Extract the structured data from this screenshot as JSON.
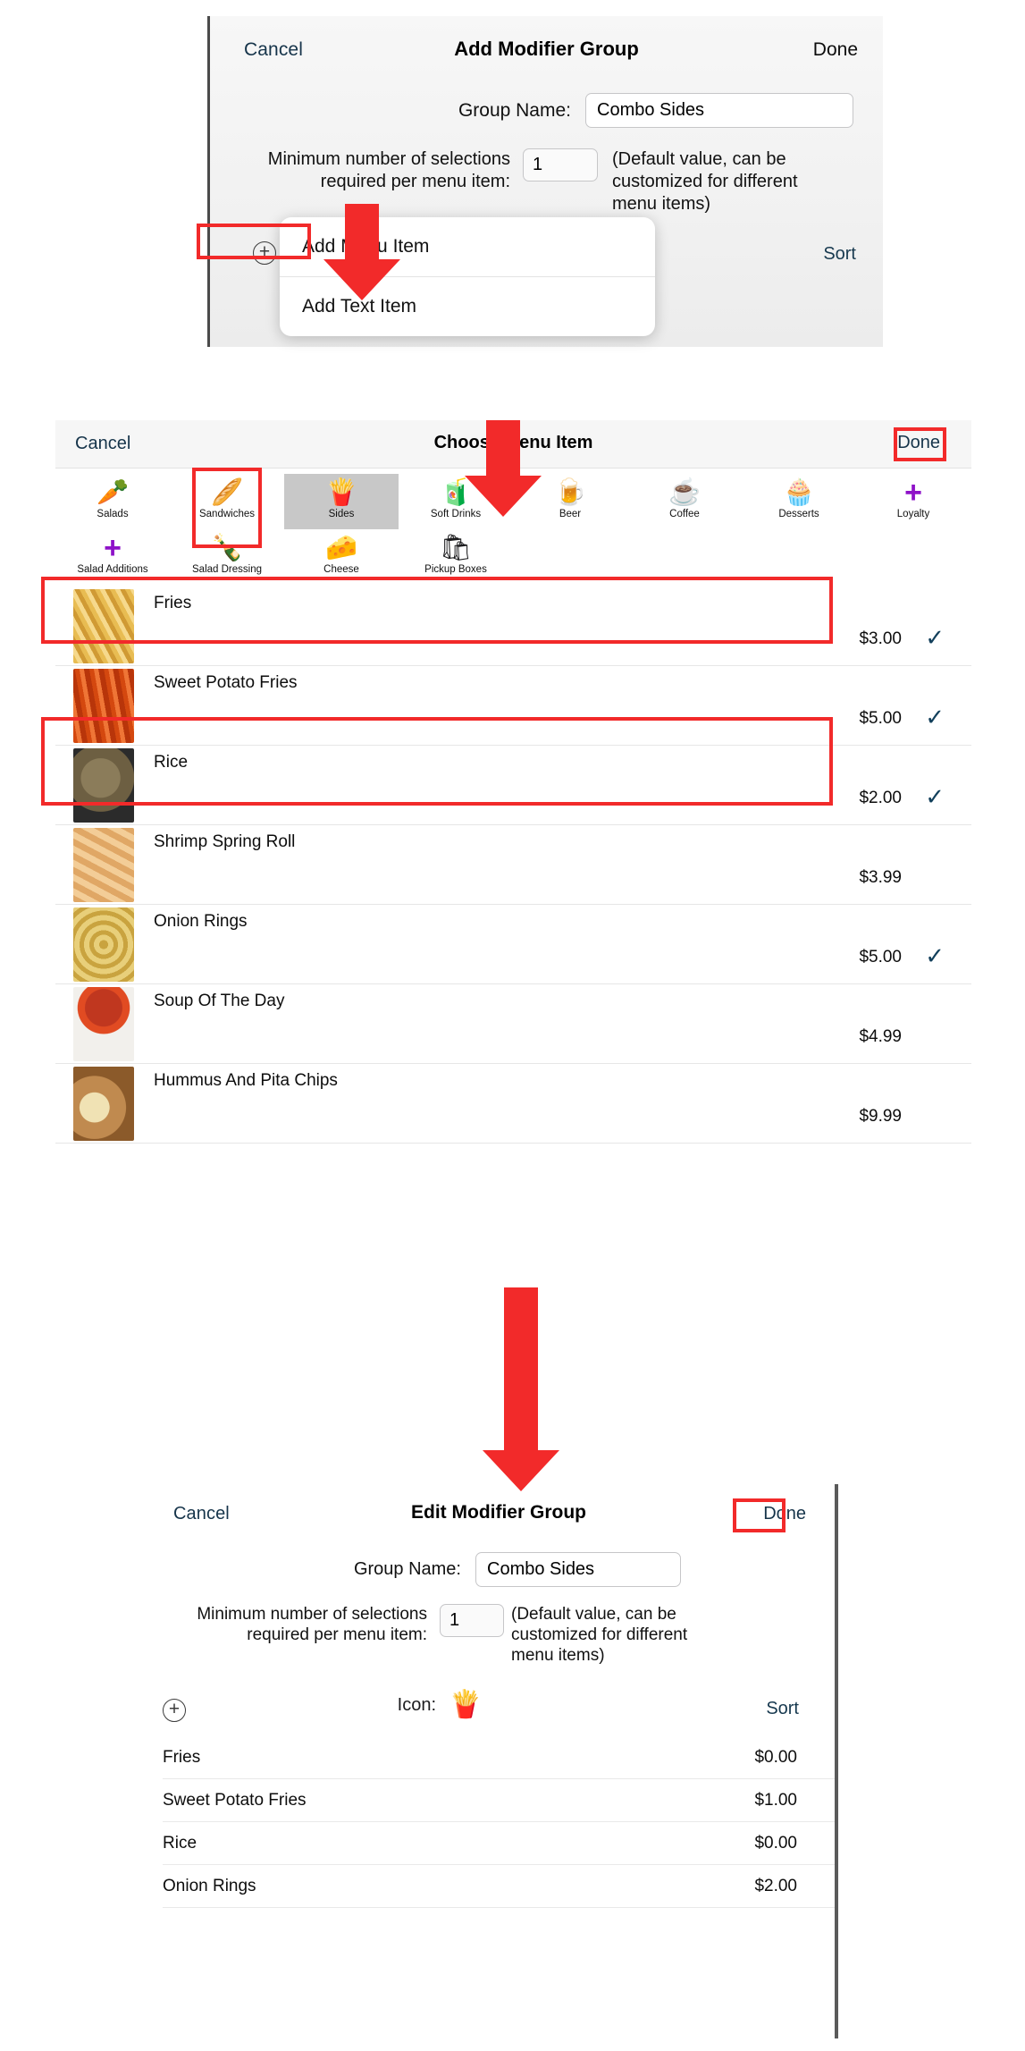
{
  "add_panel": {
    "cancel": "Cancel",
    "title": "Add Modifier Group",
    "done": "Done",
    "group_name_label": "Group Name:",
    "group_name_value": "Combo Sides",
    "min_label": "Minimum number of selections required per menu item:",
    "min_value": "1",
    "min_hint": "(Default value, can be customized for different menu items)",
    "sort": "Sort",
    "dropdown": {
      "items": [
        "Add Menu Item",
        "Add Text Item"
      ]
    }
  },
  "choose_panel": {
    "cancel": "Cancel",
    "title": "Choose Menu Item",
    "done": "Done",
    "categories": [
      {
        "label": "Salads",
        "icon": "carrot-icon",
        "glyph": "🥕",
        "selected": false,
        "plus": false
      },
      {
        "label": "Sandwiches",
        "icon": "bread-icon",
        "glyph": "🥖",
        "selected": false,
        "plus": false
      },
      {
        "label": "Sides",
        "icon": "fries-icon",
        "glyph": "🍟",
        "selected": true,
        "plus": false
      },
      {
        "label": "Soft Drinks",
        "icon": "bottle-icon",
        "glyph": "🧃",
        "selected": false,
        "plus": false
      },
      {
        "label": "Beer",
        "icon": "beer-icon",
        "glyph": "🍺",
        "selected": false,
        "plus": false
      },
      {
        "label": "Coffee",
        "icon": "coffee-cup-icon",
        "glyph": "☕",
        "selected": false,
        "plus": false
      },
      {
        "label": "Desserts",
        "icon": "cupcake-icon",
        "glyph": "🧁",
        "selected": false,
        "plus": false
      },
      {
        "label": "Loyalty",
        "icon": "plus-icon",
        "glyph": "+",
        "selected": false,
        "plus": true
      },
      {
        "label": "Salad Additions",
        "icon": "plus-icon",
        "glyph": "+",
        "selected": false,
        "plus": true
      },
      {
        "label": "Salad Dressing",
        "icon": "bottle-icon",
        "glyph": "🍾",
        "selected": false,
        "plus": false
      },
      {
        "label": "Cheese",
        "icon": "cheese-icon",
        "glyph": "🧀",
        "selected": false,
        "plus": false
      },
      {
        "label": "Pickup Boxes",
        "icon": "shopping-bag-icon",
        "glyph": "🛍",
        "selected": false,
        "plus": false
      }
    ],
    "items": [
      {
        "name": "Fries",
        "price": "$3.00",
        "selected": true,
        "thumb": "t-fries"
      },
      {
        "name": "Sweet Potato Fries",
        "price": "$5.00",
        "selected": true,
        "thumb": "t-spfries"
      },
      {
        "name": "Rice",
        "price": "$2.00",
        "selected": true,
        "thumb": "t-rice"
      },
      {
        "name": "Shrimp Spring Roll",
        "price": "$3.99",
        "selected": false,
        "thumb": "t-roll"
      },
      {
        "name": "Onion Rings",
        "price": "$5.00",
        "selected": true,
        "thumb": "t-onion"
      },
      {
        "name": "Soup Of The Day",
        "price": "$4.99",
        "selected": false,
        "thumb": "t-soup"
      },
      {
        "name": "Hummus And Pita Chips",
        "price": "$9.99",
        "selected": false,
        "thumb": "t-hummus"
      }
    ],
    "check_mark": "✓"
  },
  "edit_panel": {
    "cancel": "Cancel",
    "title": "Edit Modifier Group",
    "done": "Done",
    "group_name_label": "Group Name:",
    "group_name_value": "Combo Sides",
    "min_label": "Minimum number of selections required per menu item:",
    "min_value": "1",
    "min_hint": "(Default value, can be customized for different menu items)",
    "icon_label": "Icon:",
    "icon_glyph": "🍟",
    "sort": "Sort",
    "modifiers": [
      {
        "name": "Fries",
        "price": "$0.00"
      },
      {
        "name": "Sweet Potato Fries",
        "price": "$1.00"
      },
      {
        "name": "Rice",
        "price": "$0.00"
      },
      {
        "name": "Onion Rings",
        "price": "$2.00"
      }
    ]
  },
  "annotations": {
    "highlight_color": "#f22a2a",
    "arrow_color": "#f22a2a"
  }
}
